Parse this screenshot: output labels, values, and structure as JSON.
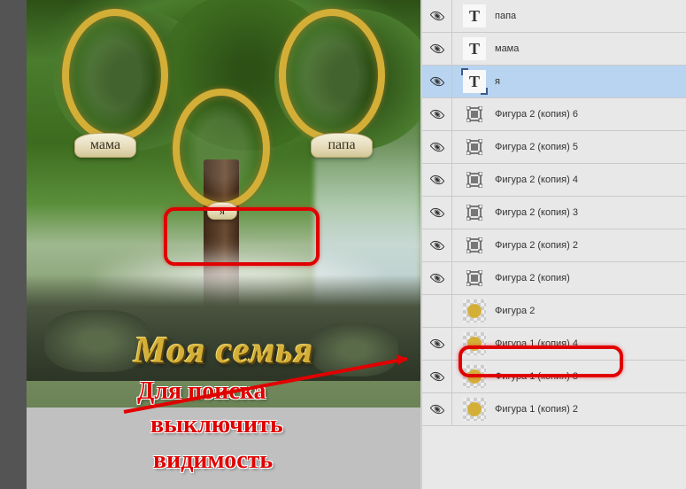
{
  "canvas": {
    "title": "Моя семья",
    "frames": {
      "mama_label": "мама",
      "papa_label": "папа",
      "ya_label": "я"
    }
  },
  "annotation": {
    "line1": "Для поиска",
    "line2": "выключить",
    "line3": "видимость"
  },
  "layers": [
    {
      "type": "text",
      "name": "папа",
      "visible": true,
      "selected": false
    },
    {
      "type": "text",
      "name": "мама",
      "visible": true,
      "selected": false
    },
    {
      "type": "text",
      "name": "я",
      "visible": true,
      "selected": true
    },
    {
      "type": "shape",
      "name": "Фигура 2 (копия) 6",
      "visible": true,
      "selected": false
    },
    {
      "type": "shape",
      "name": "Фигура 2 (копия) 5",
      "visible": true,
      "selected": false
    },
    {
      "type": "shape",
      "name": "Фигура 2 (копия) 4",
      "visible": true,
      "selected": false
    },
    {
      "type": "shape",
      "name": "Фигура 2 (копия) 3",
      "visible": true,
      "selected": false
    },
    {
      "type": "shape",
      "name": "Фигура 2 (копия) 2",
      "visible": true,
      "selected": false
    },
    {
      "type": "shape",
      "name": "Фигура 2 (копия)",
      "visible": true,
      "selected": false
    },
    {
      "type": "image",
      "name": "Фигура 2",
      "visible": false,
      "selected": false,
      "highlighted": true
    },
    {
      "type": "image",
      "name": "Фигура 1 (копия) 4",
      "visible": true,
      "selected": false
    },
    {
      "type": "image",
      "name": "Фигура 1 (копия) 3",
      "visible": true,
      "selected": false
    },
    {
      "type": "image",
      "name": "Фигура 1 (копия) 2",
      "visible": true,
      "selected": false
    }
  ],
  "icons": {
    "text_glyph": "T"
  }
}
